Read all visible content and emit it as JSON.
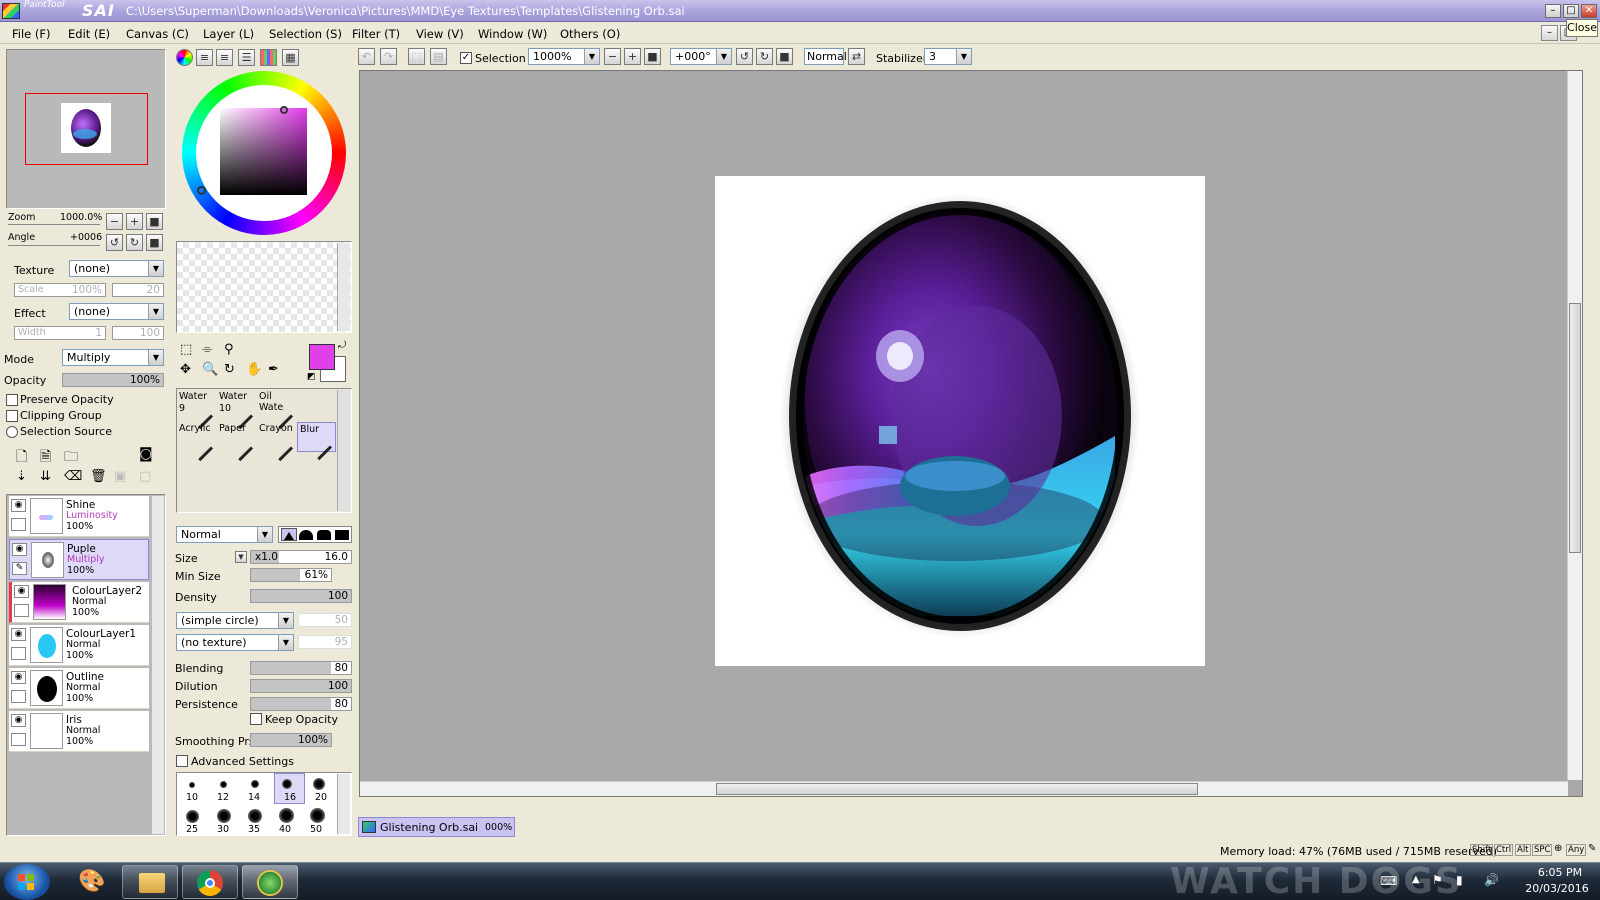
{
  "window": {
    "logo_small": "PaintTool",
    "logo_big": "SAI",
    "path": "C:\\Users\\Superman\\Downloads\\Veronica\\Pictures\\MMD\\Eye Textures\\Templates\\Glistening Orb.sai",
    "close_tooltip": "Close"
  },
  "menu": [
    "File (F)",
    "Edit (E)",
    "Canvas (C)",
    "Layer (L)",
    "Selection (S)",
    "Filter (T)",
    "View (V)",
    "Window (W)",
    "Others (O)"
  ],
  "navigator": {
    "zoom_label": "Zoom",
    "zoom_value": "1000.0%",
    "angle_label": "Angle",
    "angle_value": "+0006"
  },
  "paper": {
    "texture_label": "Texture",
    "texture_value": "(none)",
    "scale_label": "Scale",
    "scale_value": "100%",
    "scale_num": "20",
    "effect_label": "Effect",
    "effect_value": "(none)",
    "width_label": "Width",
    "width_value": "1",
    "width_num": "100"
  },
  "layer_props": {
    "mode_label": "Mode",
    "mode_value": "Multiply",
    "opacity_label": "Opacity",
    "opacity_value": "100%",
    "opacity_fraction": 1.0,
    "preserve_opacity": "Preserve Opacity",
    "clipping_group": "Clipping Group",
    "selection_source": "Selection Source"
  },
  "layers": [
    {
      "name": "Shine",
      "mode": "Luminosity",
      "opacity": "100%",
      "mode_color": "#b23ab8",
      "selected": false
    },
    {
      "name": "Puple",
      "mode": "Multiply",
      "opacity": "100%",
      "mode_color": "#b23ab8",
      "selected": true
    },
    {
      "name": "ColourLayer2",
      "mode": "Normal",
      "opacity": "100%",
      "mode_color": "#000000",
      "selected": false
    },
    {
      "name": "ColourLayer1",
      "mode": "Normal",
      "opacity": "100%",
      "mode_color": "#000000",
      "selected": false
    },
    {
      "name": "Outline",
      "mode": "Normal",
      "opacity": "100%",
      "mode_color": "#000000",
      "selected": false
    },
    {
      "name": "Iris",
      "mode": "Normal",
      "opacity": "100%",
      "mode_color": "#000000",
      "selected": false
    }
  ],
  "colors": {
    "primary": "#e040e8",
    "secondary": "#ffffff",
    "selection_highlight": "#ddd9f7",
    "canvas_bg": "#a8a8a8"
  },
  "tools": [
    {
      "name": "Water",
      "size": "9",
      "selected": false
    },
    {
      "name": "Water",
      "size": "10",
      "selected": false
    },
    {
      "name": "Oil Wate",
      "size": "",
      "selected": false
    },
    {
      "name": "Acrylic",
      "size": "",
      "selected": false
    },
    {
      "name": "Paper",
      "size": "",
      "selected": false
    },
    {
      "name": "Crayon",
      "size": "",
      "selected": false
    },
    {
      "name": "Blur",
      "size": "",
      "selected": true
    }
  ],
  "brush": {
    "blend_mode": "Normal",
    "size_label": "Size",
    "size_mult": "x1.0",
    "size_value": "16.0",
    "min_size_label": "Min Size",
    "min_size_value": "61%",
    "min_size_fraction": 0.61,
    "density_label": "Density",
    "density_value": "100",
    "density_fraction": 1.0,
    "shape": "(simple circle)",
    "shape_num": "50",
    "texture": "(no texture)",
    "texture_num": "95",
    "blending_label": "Blending",
    "blending_value": "80",
    "blending_fraction": 0.8,
    "dilution_label": "Dilution",
    "dilution_value": "100",
    "dilution_fraction": 1.0,
    "persistence_label": "Persistence",
    "persistence_value": "80",
    "persistence_fraction": 0.8,
    "keep_opacity": "Keep Opacity",
    "smoothing_label": "Smoothing Prs",
    "smoothing_value": "100%",
    "smoothing_fraction": 1.0,
    "advanced_settings": "Advanced Settings",
    "presets_row1": [
      "10",
      "12",
      "14",
      "16",
      "20"
    ],
    "presets_row2": [
      "25",
      "30",
      "35",
      "40",
      "50"
    ],
    "preset_selected": "16"
  },
  "toolbar": {
    "selection_label": "Selection",
    "zoom_value": "1000%",
    "angle_value": "+000°",
    "blend_value": "Normal",
    "stabilizer_label": "Stabilizer",
    "stabilizer_value": "3"
  },
  "document_tab": {
    "name": "Glistening Orb.sai",
    "zoom": "000%"
  },
  "status": {
    "memory": "Memory load: 47% (76MB used / 715MB reserved)",
    "keys": [
      "Shift",
      "Ctrl",
      "Alt",
      "SPC",
      "Any"
    ]
  },
  "taskbar": {
    "time": "6:05 PM",
    "date": "20/03/2016",
    "wallpaper_text": "WATCH DOGS"
  }
}
